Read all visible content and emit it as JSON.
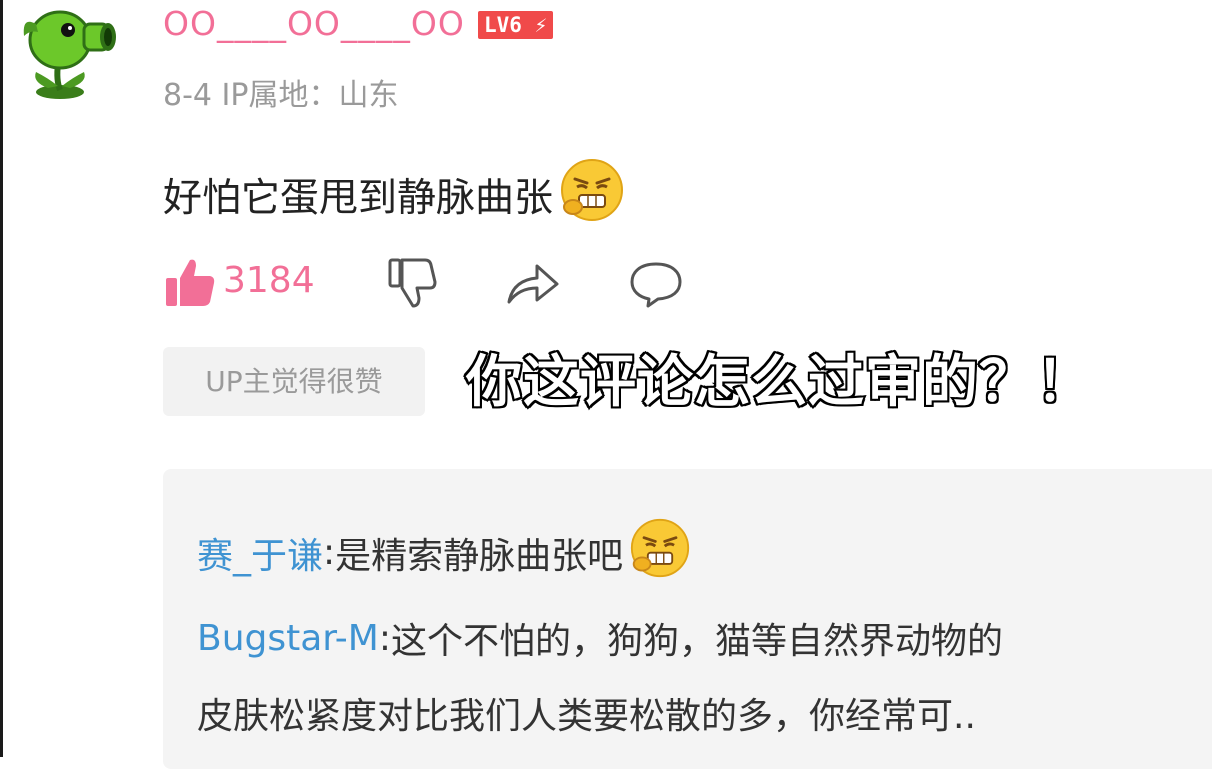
{
  "comment": {
    "username": "OO____OO____OO",
    "level_badge": "LV6 ⚡",
    "meta": "8-4  IP属地：山东",
    "text": "好怕它蛋甩到静脉曲张",
    "emoji_name": "grimace-emoji",
    "likes": "3184",
    "up_badge": "UP主觉得很赞"
  },
  "overlay_caption": "你这评论怎么过审的？！",
  "replies": [
    {
      "user": "赛_于谦",
      "sep": ":",
      "text": " 是精索静脉曲张吧"
    },
    {
      "user": "Bugstar-M",
      "sep": ":",
      "text": " 这个不怕的，狗狗，猫等自然界动物的",
      "continuation": "皮肤松紧度对比我们人类要松散的多，你经常可.."
    }
  ],
  "colors": {
    "username_pink": "#f26f97",
    "reply_user_blue": "#3f93d2",
    "level_red": "#f04a4a"
  }
}
